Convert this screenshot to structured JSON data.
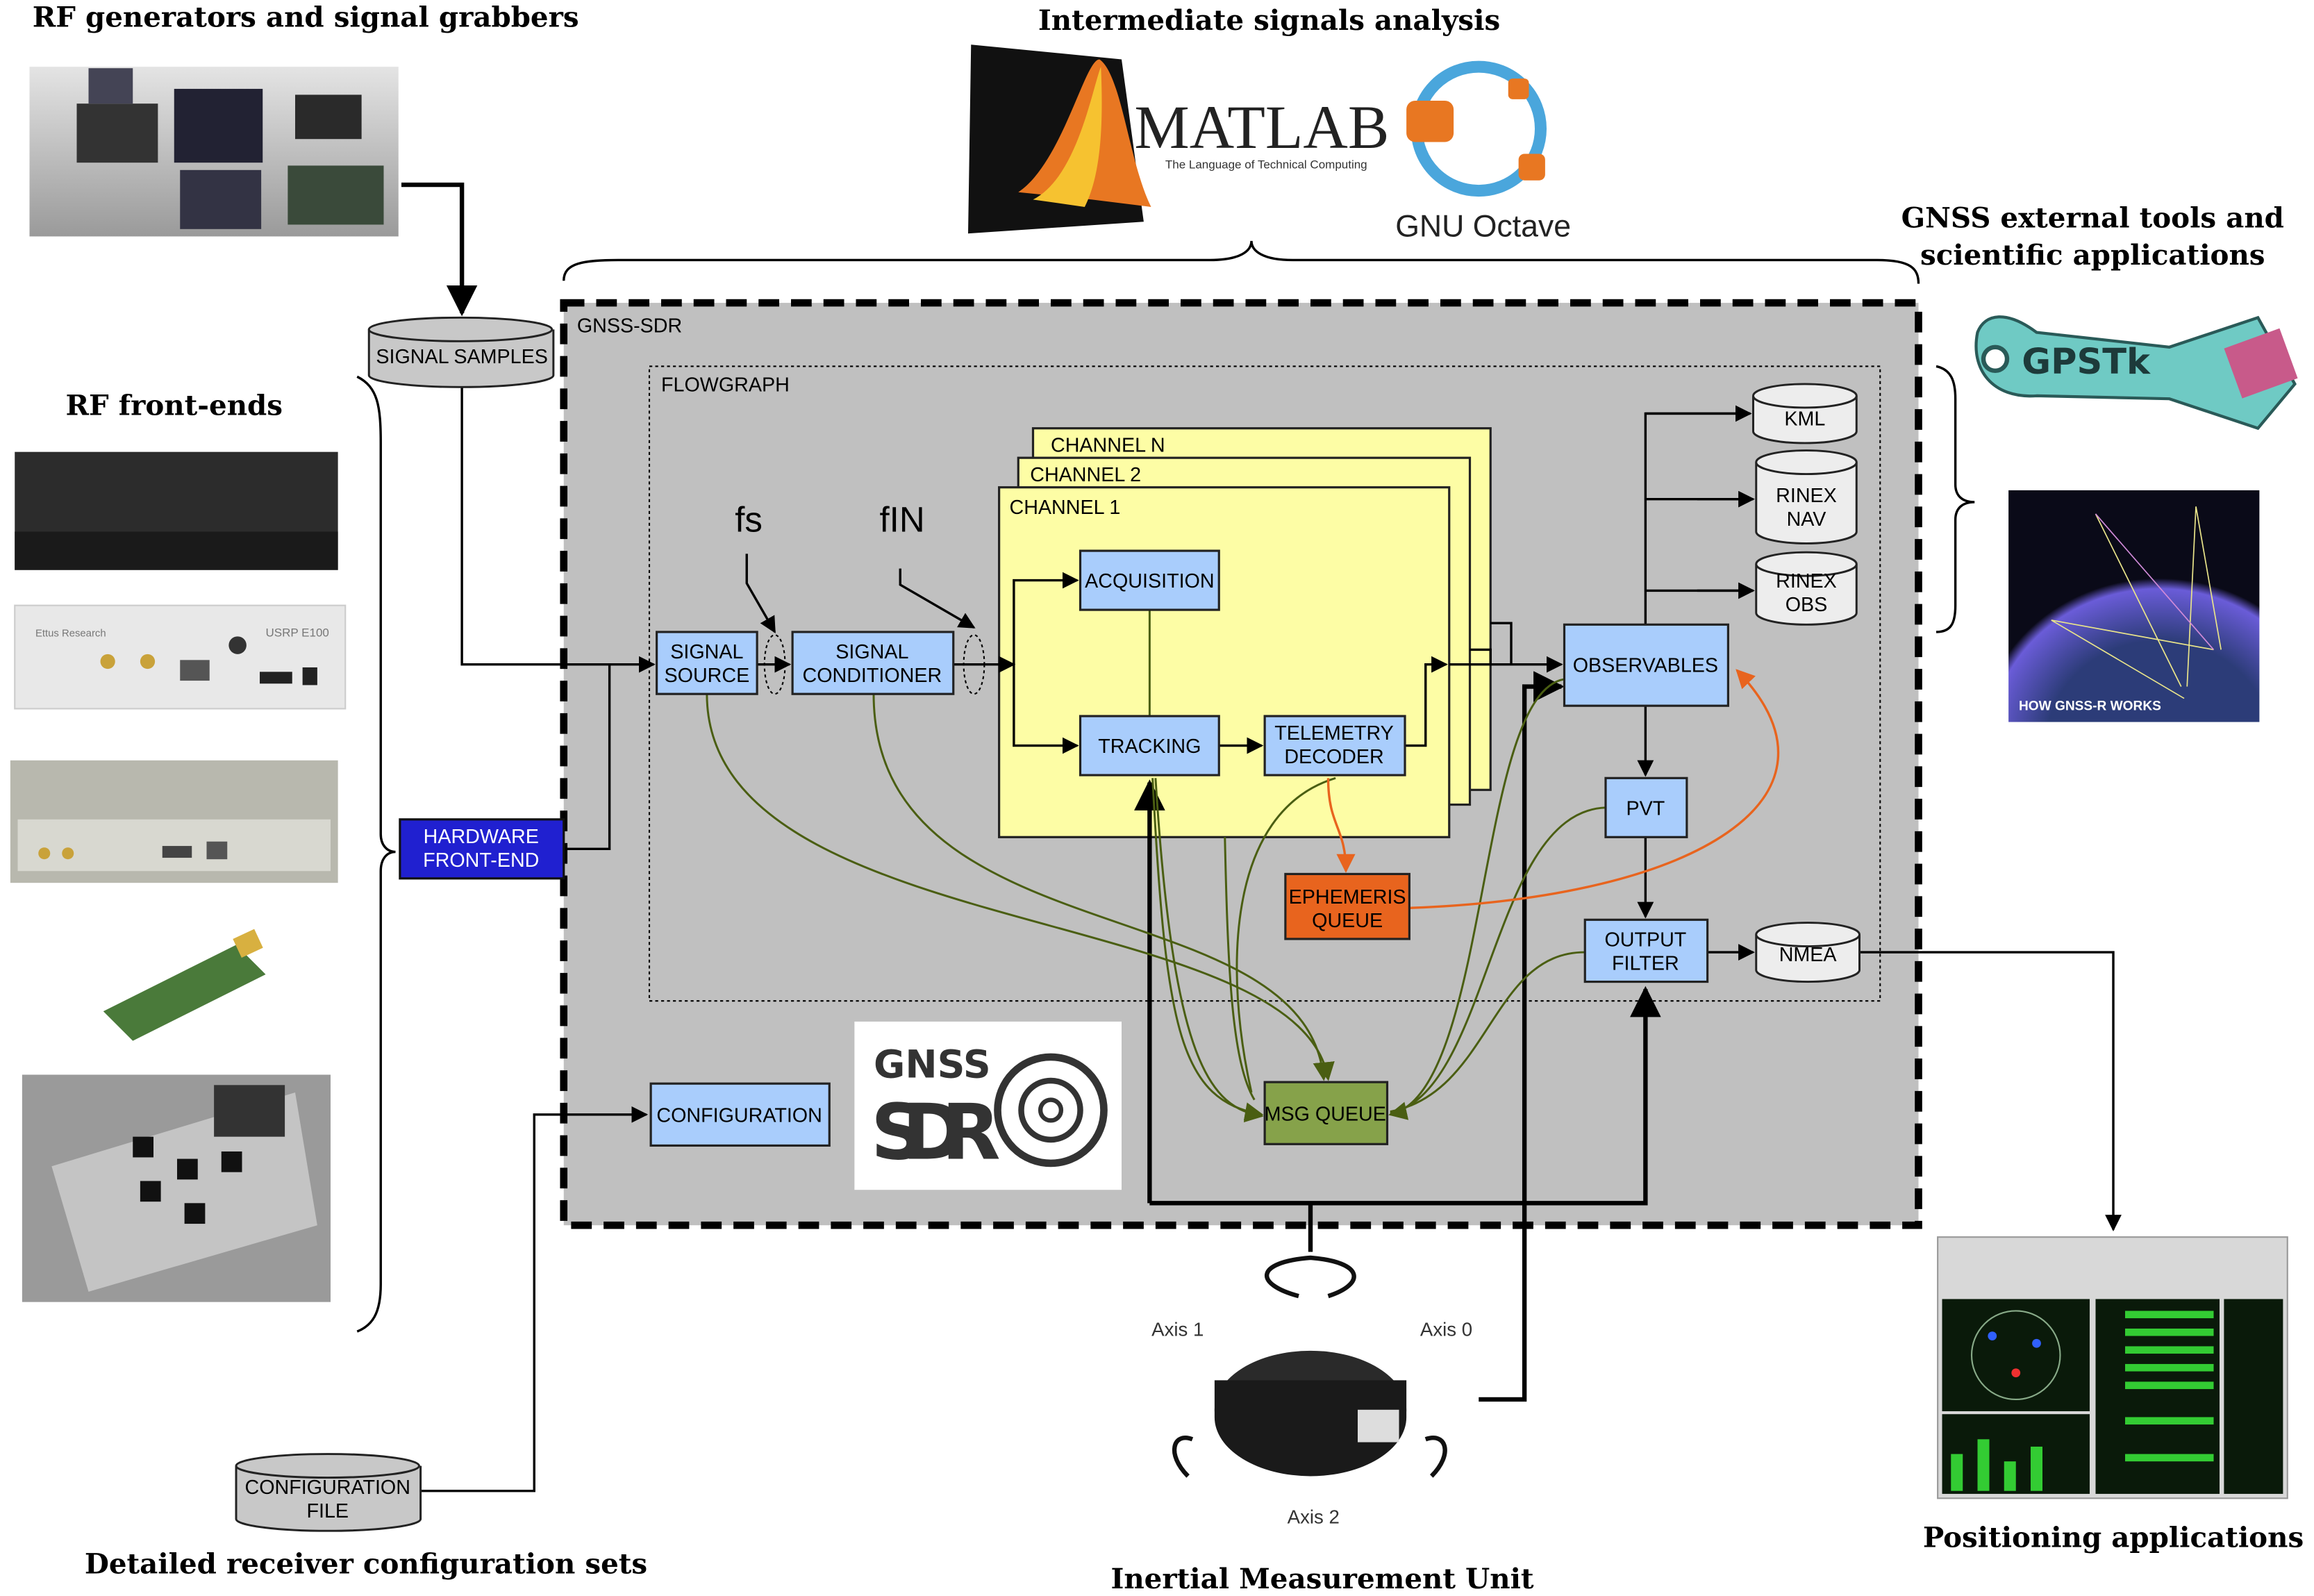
{
  "headings": {
    "rf_generators": "RF generators and signal grabbers",
    "intermediate": "Intermediate signals analysis",
    "gnss_tools_1": "GNSS external tools and",
    "gnss_tools_2": "scientific applications",
    "rf_frontends": "RF front-ends",
    "config_sets": "Detailed receiver configuration sets",
    "imu": "Inertial Measurement Unit",
    "positioning": "Positioning applications"
  },
  "logos": {
    "matlab": "MATLAB",
    "matlab_tagline": "The Language of Technical Computing",
    "octave": "GNU Octave",
    "gpstk": "GPSTk",
    "gnss_sdr_top": "GNSS",
    "gnss_sdr_bottom": "SDR",
    "gnssr_title": "HOW GNSS-R WORKS",
    "usrp_brand": "Ettus Research",
    "usrp_model": "USRP E100",
    "imu_axis0": "Axis 0",
    "imu_axis1": "Axis 1",
    "imu_axis2": "Axis 2"
  },
  "diagram": {
    "gnss_sdr_label": "GNSS-SDR",
    "flowgraph_label": "FLOWGRAPH",
    "channel_n": "CHANNEL N",
    "channel_2": "CHANNEL 2",
    "channel_1": "CHANNEL 1",
    "fs": "fs",
    "fin": "fIN",
    "signal_samples": "SIGNAL SAMPLES",
    "hardware_frontend": [
      "HARDWARE",
      "FRONT-END"
    ],
    "signal_source": [
      "SIGNAL",
      "SOURCE"
    ],
    "signal_conditioner": [
      "SIGNAL",
      "CONDITIONER"
    ],
    "acquisition": "ACQUISITION",
    "tracking": "TRACKING",
    "telemetry_decoder": [
      "TELEMETRY",
      "DECODER"
    ],
    "ephemeris_queue": [
      "EPHEMERIS",
      "QUEUE"
    ],
    "msg_queue": "MSG QUEUE",
    "observables": "OBSERVABLES",
    "pvt": "PVT",
    "output_filter": [
      "OUTPUT",
      "FILTER"
    ],
    "kml": "KML",
    "rinex_nav": [
      "RINEX",
      "NAV"
    ],
    "rinex_obs": [
      "RINEX",
      "OBS"
    ],
    "nmea": "NMEA",
    "configuration": "CONFIGURATION",
    "configuration_file": [
      "CONFIGURATION",
      "FILE"
    ]
  },
  "colors": {
    "block": "#a9cdfc",
    "channel": "#fdfda5",
    "ephemeris": "#e8641e",
    "msg_queue": "#86a24a",
    "hardware": "#2020d0",
    "sdr_area": "#c0c0c0"
  }
}
